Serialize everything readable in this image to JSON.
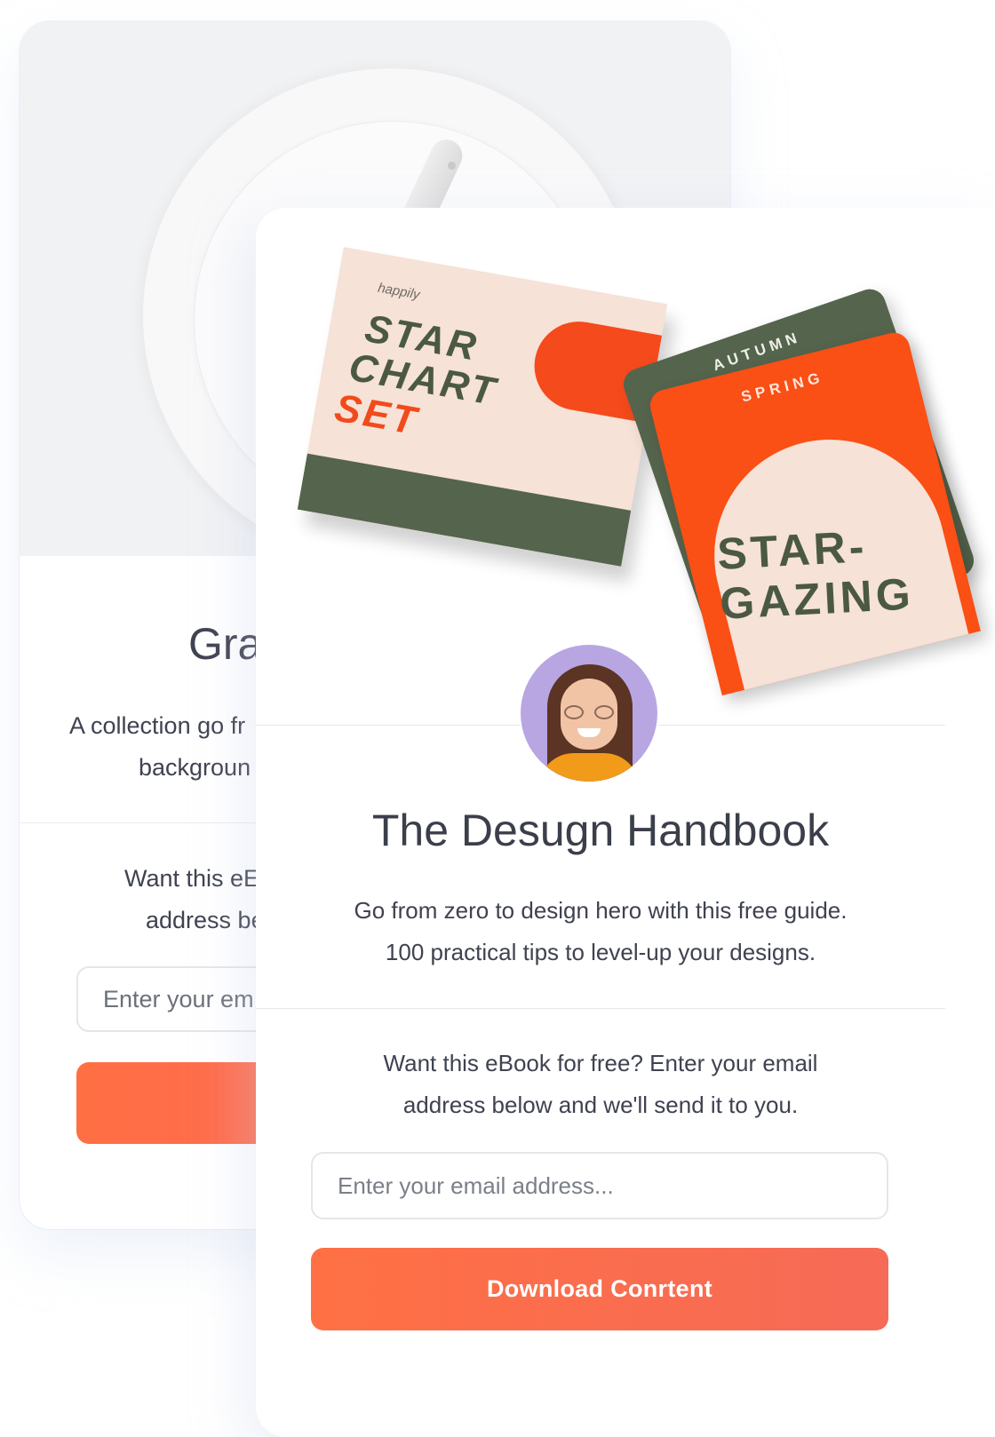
{
  "back_card": {
    "title": "Gra",
    "description_lines": [
      "A collection go fr",
      "backgroun"
    ],
    "prompt_lines": [
      "Want this eE",
      "address be"
    ],
    "email_placeholder": "Enter your em"
  },
  "front_card": {
    "booklet": {
      "brand": "happily",
      "title_lines": [
        "STAR",
        "CHART",
        "SET"
      ]
    },
    "cards": {
      "back_label": "AUTUMN",
      "front_label": "SPRING",
      "title_lines": [
        "STAR-",
        "GAZING"
      ]
    },
    "title": "The Desugn Handbook",
    "description_lines": [
      "Go from zero to design hero with this free guide.",
      "100 practical tips to level-up your designs."
    ],
    "prompt_lines": [
      "Want this eBook for free? Enter your email",
      "address below and we'll send it to you."
    ],
    "email_placeholder": "Enter your email address...",
    "button_label": "Download Conrtent"
  },
  "colors": {
    "accent_orange": "#ff6f43",
    "accent_end": "#f66a57",
    "olive_green": "#55644c",
    "cream": "#f6e2d6",
    "avatar_bg": "#b8a6e2"
  }
}
